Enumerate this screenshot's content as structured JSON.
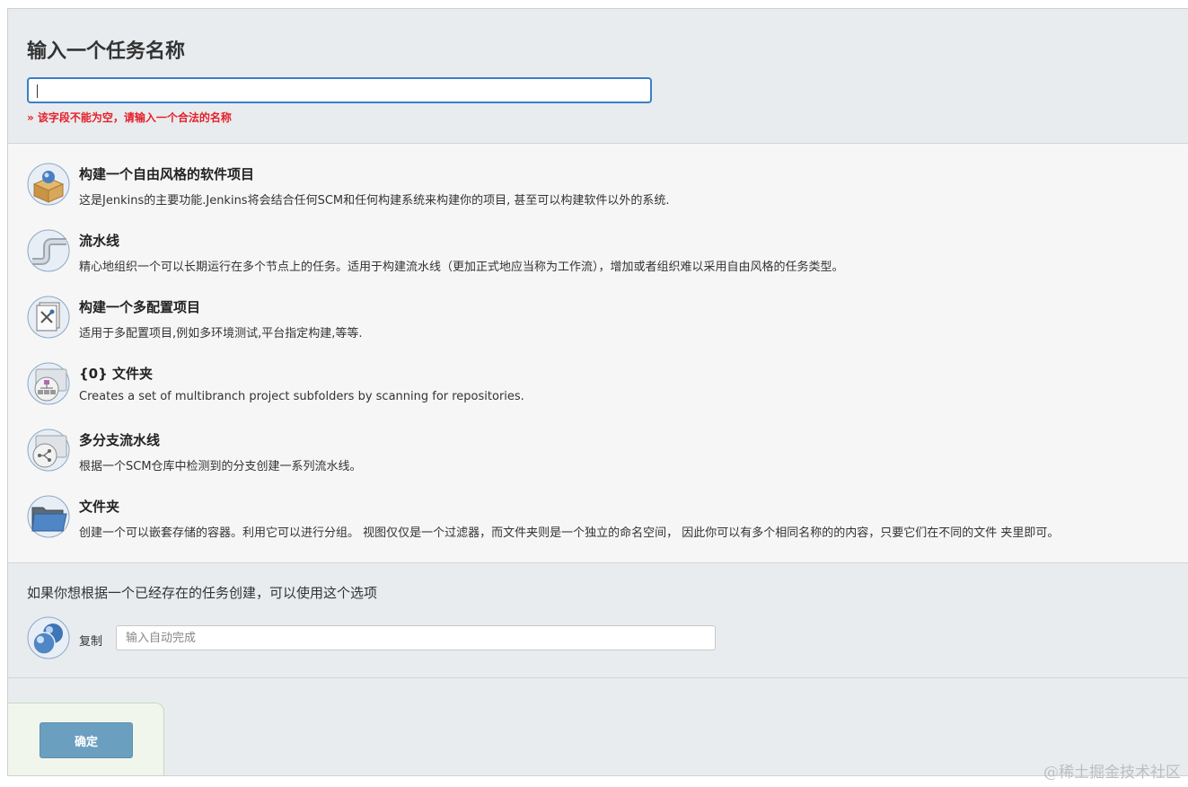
{
  "form": {
    "title": "输入一个任务名称",
    "name_input_value": "",
    "error_message": "» 该字段不能为空，请输入一个合法的名称"
  },
  "item_types": [
    {
      "icon": "freestyle-project-icon",
      "title": "构建一个自由风格的软件项目",
      "description": "这是Jenkins的主要功能.Jenkins将会结合任何SCM和任何构建系统来构建你的项目, 甚至可以构建软件以外的系统."
    },
    {
      "icon": "pipeline-icon",
      "title": "流水线",
      "description": "精心地组织一个可以长期运行在多个节点上的任务。适用于构建流水线（更加正式地应当称为工作流），增加或者组织难以采用自由风格的任务类型。"
    },
    {
      "icon": "multi-configuration-project-icon",
      "title": "构建一个多配置项目",
      "description": "适用于多配置项目,例如多环境测试,平台指定构建,等等."
    },
    {
      "icon": "organization-folder-icon",
      "title": "{0} 文件夹",
      "description": "Creates a set of multibranch project subfolders by scanning for repositories."
    },
    {
      "icon": "multibranch-pipeline-icon",
      "title": "多分支流水线",
      "description": "根据一个SCM仓库中检测到的分支创建一系列流水线。"
    },
    {
      "icon": "folder-icon",
      "title": "文件夹",
      "description": "创建一个可以嵌套存储的容器。利用它可以进行分组。 视图仅仅是一个过滤器，而文件夹则是一个独立的命名空间， 因此你可以有多个相同名称的的内容，只要它们在不同的文件 夹里即可。"
    }
  ],
  "copy": {
    "heading": "如果你想根据一个已经存在的任务创建，可以使用这个选项",
    "label": "复制",
    "placeholder": "输入自动完成",
    "icon": "copy-job-icon"
  },
  "footer": {
    "ok_label": "确定"
  },
  "watermark": "@稀土掘金技术社区",
  "colors": {
    "accent": "#3a7fc7",
    "error": "#e4202a",
    "button": "#6b9fc0"
  }
}
